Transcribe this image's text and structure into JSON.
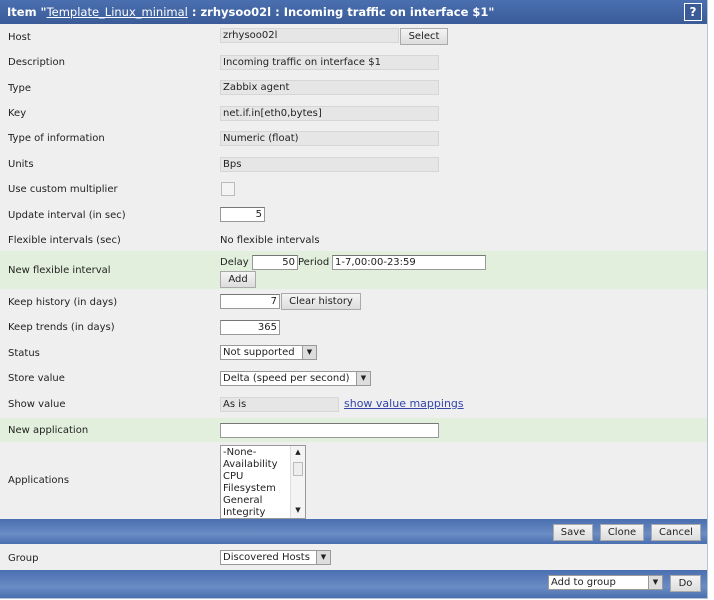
{
  "header": {
    "prefix": "Item \"",
    "template": "Template_Linux_minimal",
    "suffix": " : zrhysoo02l : Incoming traffic on interface $1\"",
    "help": "?"
  },
  "labels": {
    "host": "Host",
    "description": "Description",
    "type": "Type",
    "key": "Key",
    "type_info": "Type of information",
    "units": "Units",
    "custom_multiplier": "Use custom multiplier",
    "update_interval": "Update interval (in sec)",
    "flexible": "Flexible intervals (sec)",
    "new_flexible": "New flexible interval",
    "keep_history": "Keep history (in days)",
    "keep_trends": "Keep trends (in days)",
    "status": "Status",
    "store_value": "Store value",
    "show_value": "Show value",
    "new_application": "New application",
    "applications": "Applications",
    "group": "Group"
  },
  "values": {
    "host": "zrhysoo02l",
    "description": "Incoming traffic on interface $1",
    "type": "Zabbix agent",
    "key": "net.if.in[eth0,bytes]",
    "type_info": "Numeric (float)",
    "units": "Bps",
    "update_interval": "5",
    "flexible": "No flexible intervals",
    "delay_label": "Delay",
    "delay": "50",
    "period_label": "Period",
    "period": "1-7,00:00-23:59",
    "keep_history": "7",
    "keep_trends": "365",
    "status": "Not supported",
    "store_value": "Delta (speed per second)",
    "show_value": "As is",
    "new_application": "",
    "group": "Discovered Hosts",
    "action": "Add to group"
  },
  "applications": [
    "-None-",
    "Availability",
    "CPU",
    "Filesystem",
    "General",
    "Integrity"
  ],
  "buttons": {
    "select": "Select",
    "add": "Add",
    "clear_history": "Clear history",
    "show_mappings": "show value mappings",
    "save": "Save",
    "clone": "Clone",
    "cancel": "Cancel",
    "do": "Do"
  }
}
